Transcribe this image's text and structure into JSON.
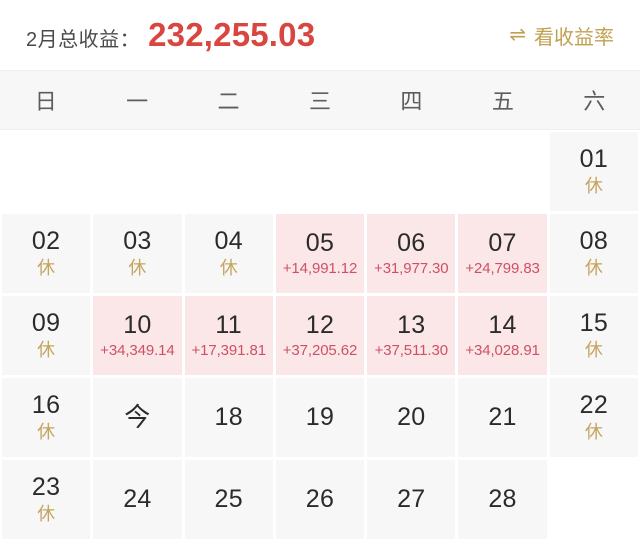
{
  "header": {
    "label": "2月总收益：",
    "total": "232,255.03",
    "toggle_icon": "swap-arrows-icon",
    "toggle_glyph": "⇌",
    "toggle_label": "看收益率",
    "total_color": "#d9453f",
    "toggle_color": "#c2a052"
  },
  "weekdays": [
    "日",
    "一",
    "二",
    "三",
    "四",
    "五",
    "六"
  ],
  "legend": {
    "rest_mark": "休",
    "today_mark": "今"
  },
  "colors": {
    "gain_cell_bg": "#fbe7e7",
    "gain_text": "#cf5066",
    "normal_cell_bg": "#f7f7f7",
    "rest_text": "#c5a45f",
    "day_text": "#2b2b2b"
  },
  "cells": [
    {
      "state": "empty",
      "day": "",
      "sub": "",
      "subtype": ""
    },
    {
      "state": "empty",
      "day": "",
      "sub": "",
      "subtype": ""
    },
    {
      "state": "empty",
      "day": "",
      "sub": "",
      "subtype": ""
    },
    {
      "state": "empty",
      "day": "",
      "sub": "",
      "subtype": ""
    },
    {
      "state": "empty",
      "day": "",
      "sub": "",
      "subtype": ""
    },
    {
      "state": "empty",
      "day": "",
      "sub": "",
      "subtype": ""
    },
    {
      "state": "filled",
      "day": "01",
      "sub": "休",
      "subtype": "rest"
    },
    {
      "state": "filled",
      "day": "02",
      "sub": "休",
      "subtype": "rest"
    },
    {
      "state": "filled",
      "day": "03",
      "sub": "休",
      "subtype": "rest"
    },
    {
      "state": "filled",
      "day": "04",
      "sub": "休",
      "subtype": "rest"
    },
    {
      "state": "gain",
      "day": "05",
      "sub": "+14,991.12",
      "subtype": "profit"
    },
    {
      "state": "gain",
      "day": "06",
      "sub": "+31,977.30",
      "subtype": "profit"
    },
    {
      "state": "gain",
      "day": "07",
      "sub": "+24,799.83",
      "subtype": "profit"
    },
    {
      "state": "filled",
      "day": "08",
      "sub": "休",
      "subtype": "rest"
    },
    {
      "state": "filled",
      "day": "09",
      "sub": "休",
      "subtype": "rest"
    },
    {
      "state": "gain",
      "day": "10",
      "sub": "+34,349.14",
      "subtype": "profit"
    },
    {
      "state": "gain",
      "day": "11",
      "sub": "+17,391.81",
      "subtype": "profit"
    },
    {
      "state": "gain",
      "day": "12",
      "sub": "+37,205.62",
      "subtype": "profit"
    },
    {
      "state": "gain",
      "day": "13",
      "sub": "+37,511.30",
      "subtype": "profit"
    },
    {
      "state": "gain",
      "day": "14",
      "sub": "+34,028.91",
      "subtype": "profit"
    },
    {
      "state": "filled",
      "day": "15",
      "sub": "休",
      "subtype": "rest"
    },
    {
      "state": "filled",
      "day": "16",
      "sub": "休",
      "subtype": "rest"
    },
    {
      "state": "filled",
      "day": "今",
      "sub": "",
      "subtype": "today"
    },
    {
      "state": "filled",
      "day": "18",
      "sub": "",
      "subtype": ""
    },
    {
      "state": "filled",
      "day": "19",
      "sub": "",
      "subtype": ""
    },
    {
      "state": "filled",
      "day": "20",
      "sub": "",
      "subtype": ""
    },
    {
      "state": "filled",
      "day": "21",
      "sub": "",
      "subtype": ""
    },
    {
      "state": "filled",
      "day": "22",
      "sub": "休",
      "subtype": "rest"
    },
    {
      "state": "filled",
      "day": "23",
      "sub": "休",
      "subtype": "rest"
    },
    {
      "state": "filled",
      "day": "24",
      "sub": "",
      "subtype": ""
    },
    {
      "state": "filled",
      "day": "25",
      "sub": "",
      "subtype": ""
    },
    {
      "state": "filled",
      "day": "26",
      "sub": "",
      "subtype": ""
    },
    {
      "state": "filled",
      "day": "27",
      "sub": "",
      "subtype": ""
    },
    {
      "state": "filled",
      "day": "28",
      "sub": "",
      "subtype": ""
    },
    {
      "state": "empty",
      "day": "",
      "sub": "",
      "subtype": ""
    }
  ]
}
